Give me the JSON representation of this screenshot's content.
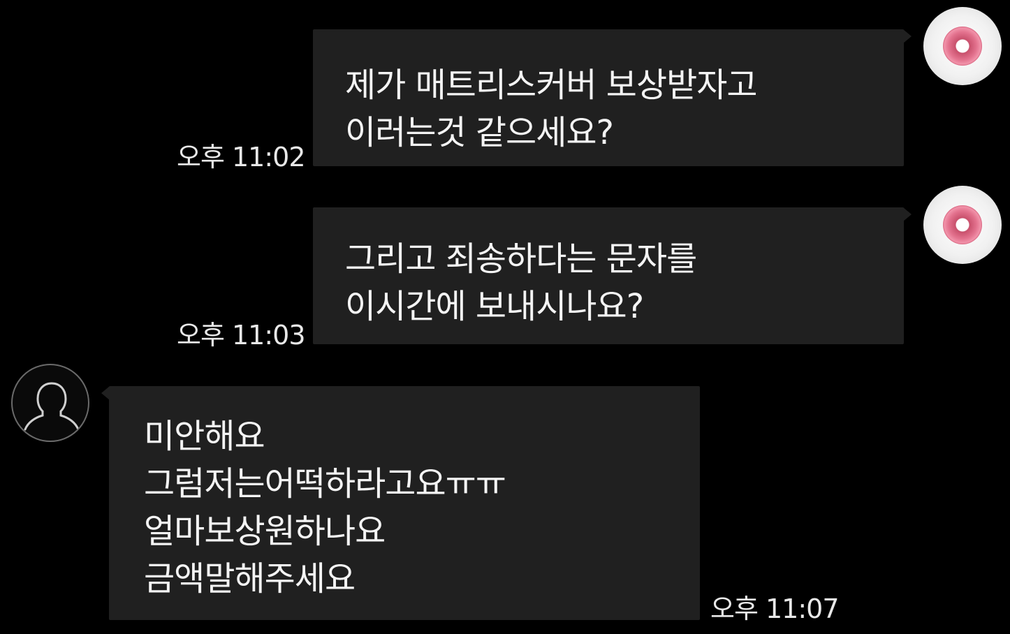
{
  "messages": [
    {
      "sender": "me",
      "lines": "제가 매트리스커버 보상받자고\n이러는것 같으세요?",
      "time": "오후 11:02",
      "avatar_icon": "donut-icon"
    },
    {
      "sender": "me",
      "lines": "그리고 죄송하다는 문자를\n이시간에 보내시나요?",
      "time": "오후 11:03",
      "avatar_icon": "donut-icon"
    },
    {
      "sender": "other",
      "lines": "미안해요\n그럼저는어떡하라고요ㅠㅠ\n얼마보상원하나요\n금액말해주세요",
      "time": "오후 11:07",
      "avatar_icon": "default-profile-icon"
    }
  ],
  "colors": {
    "background": "#000000",
    "bubble": "#202020",
    "text": "#f4f4f4",
    "donut_pink": "#e3728e"
  }
}
